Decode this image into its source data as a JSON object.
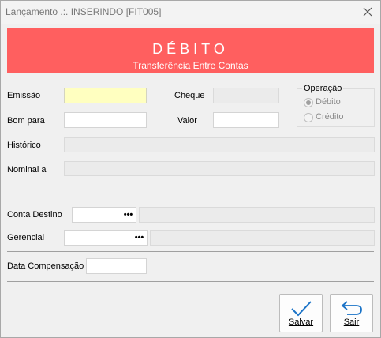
{
  "window": {
    "title": "Lançamento .:. INSERINDO [FIT005]"
  },
  "banner": {
    "title": "DÉBITO",
    "subtitle": "Transferência Entre Contas",
    "color": "#ff5f5f"
  },
  "fields": {
    "emissao_label": "Emissão",
    "bom_para_label": "Bom para",
    "cheque_label": "Cheque",
    "valor_label": "Valor",
    "historico_label": "Histórico",
    "nominal_label": "Nominal a",
    "conta_destino_label": "Conta Destino",
    "gerencial_label": "Gerencial",
    "data_compensacao_label": "Data Compensação",
    "lookup_glyph": "•••"
  },
  "operacao": {
    "label": "Operação",
    "options": [
      {
        "label": "Débito",
        "selected": true
      },
      {
        "label": "Crédito",
        "selected": false
      }
    ]
  },
  "buttons": {
    "salvar": {
      "label": "Salvar",
      "icon": "checkmark-icon"
    },
    "sair": {
      "label": "Sair",
      "icon": "return-arrow-icon"
    }
  },
  "colors": {
    "accent": "#1a73c7",
    "focused_field": "#ffffc0"
  }
}
